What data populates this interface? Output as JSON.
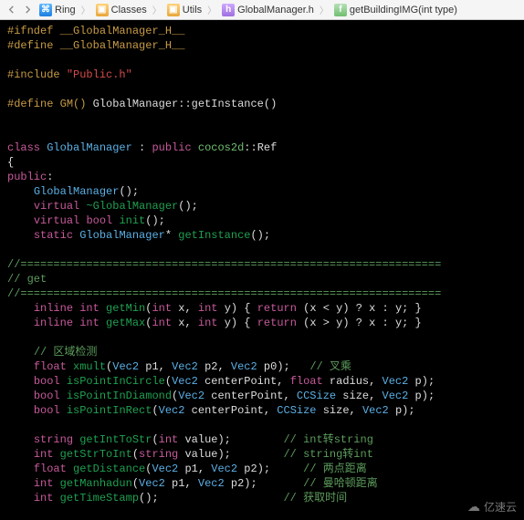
{
  "breadcrumbs": {
    "items": [
      {
        "icon": "proj",
        "label": "Ring"
      },
      {
        "icon": "fold",
        "label": "Classes"
      },
      {
        "icon": "fold",
        "label": "Utils"
      },
      {
        "icon": "h",
        "label": "GlobalManager.h"
      },
      {
        "icon": "f",
        "label": "getBuildingIMG(int type)"
      }
    ]
  },
  "code": {
    "l1_pre": "#ifndef",
    "l1_mac": "__GlobalManager_H__",
    "l2_pre": "#define",
    "l2_mac": "__GlobalManager_H__",
    "l3_pre": "#include",
    "l3_lit": "\"Public.h\"",
    "l4_pre": "#define",
    "l4_mac": "GM()",
    "l4_rest": "GlobalManager::getInstance()",
    "l5_kw_class": "class",
    "l5_cls": "GlobalManager",
    "l5_colon": " : ",
    "l5_public": "public",
    "l5_ns": "cocos2d",
    "l5_ref": "::Ref",
    "l6_brace": "{",
    "l7_public": "public",
    "l7_colon": ":",
    "l8_ctor": "GlobalManager",
    "l8_rest": "();",
    "l9_virtual": "virtual",
    "l9_fn": "~GlobalManager",
    "l9_rest": "();",
    "l10_virtual": "virtual",
    "l10_bool": "bool",
    "l10_fn": "init",
    "l10_rest": "();",
    "l11_static": "static",
    "l11_cls": "GlobalManager",
    "l11_star": "*",
    "l11_fn": "getInstance",
    "l11_rest": "();",
    "sep_line": "//================================================================",
    "sec_get": "// get",
    "l12_inline": "inline",
    "l12_int": "int",
    "l12_fn": "getMin",
    "l12_sig_a": "(",
    "l12_int2": "int",
    "l12_x": " x, ",
    "l12_int3": "int",
    "l12_y": " y) { ",
    "l12_return": "return",
    "l12_expr": " (x < y) ? x : y; }",
    "l13_inline": "inline",
    "l13_int": "int",
    "l13_fn": "getMax",
    "l13_sig_a": "(",
    "l13_int2": "int",
    "l13_x": " x, ",
    "l13_int3": "int",
    "l13_y": " y) { ",
    "l13_return": "return",
    "l13_expr": " (x > y) ? x : y; }",
    "c_region": "// 区域检测",
    "l14_float": "float",
    "l14_fn": "xmult",
    "l14_sig_a": "(",
    "l14_v1": "Vec2",
    "l14_p1": " p1, ",
    "l14_v2": "Vec2",
    "l14_p2": " p2, ",
    "l14_v3": "Vec2",
    "l14_p0": " p0);   ",
    "l14_c": "// 叉乘",
    "l15_bool": "bool",
    "l15_fn": "isPointInCircle",
    "l15_sig_a": "(",
    "l15_v1": "Vec2",
    "l15_cp": " centerPoint, ",
    "l15_float": "float",
    "l15_r": " radius, ",
    "l15_v2": "Vec2",
    "l15_e": " p);",
    "l16_bool": "bool",
    "l16_fn": "isPointInDiamond",
    "l16_sig_a": "(",
    "l16_v1": "Vec2",
    "l16_cp": " centerPoint, ",
    "l16_cc": "CCSize",
    "l16_sz": " size, ",
    "l16_v2": "Vec2",
    "l16_e": " p);",
    "l17_bool": "bool",
    "l17_fn": "isPointInRect",
    "l17_sig_a": "(",
    "l17_v1": "Vec2",
    "l17_cp": " centerPoint, ",
    "l17_cc": "CCSize",
    "l17_sz": " size, ",
    "l17_v2": "Vec2",
    "l17_e": " p);",
    "l18_string": "string",
    "l18_fn": "getIntToStr",
    "l18_sig_a": "(",
    "l18_int": "int",
    "l18_val": " value);",
    "l18_c": "// int转string",
    "l19_int": "int",
    "l19_fn": "getStrToInt",
    "l19_sig_a": "(",
    "l19_string": "string",
    "l19_val": " value);",
    "l19_c": "// string转int",
    "l20_float": "float",
    "l20_fn": "getDistance",
    "l20_sig_a": "(",
    "l20_v1": "Vec2",
    "l20_p1": " p1, ",
    "l20_v2": "Vec2",
    "l20_p2": " p2);",
    "l20_c": "// 两点距离",
    "l21_int": "int",
    "l21_fn": "getManhadun",
    "l21_sig_a": "(",
    "l21_v1": "Vec2",
    "l21_p1": " p1, ",
    "l21_v2": "Vec2",
    "l21_p2": " p2);",
    "l21_c": "// 曼哈顿距离",
    "l22_int": "int",
    "l22_fn": "getTimeStamp",
    "l22_rest": "();",
    "l22_c": "// 获取时间"
  },
  "watermark": "亿速云"
}
